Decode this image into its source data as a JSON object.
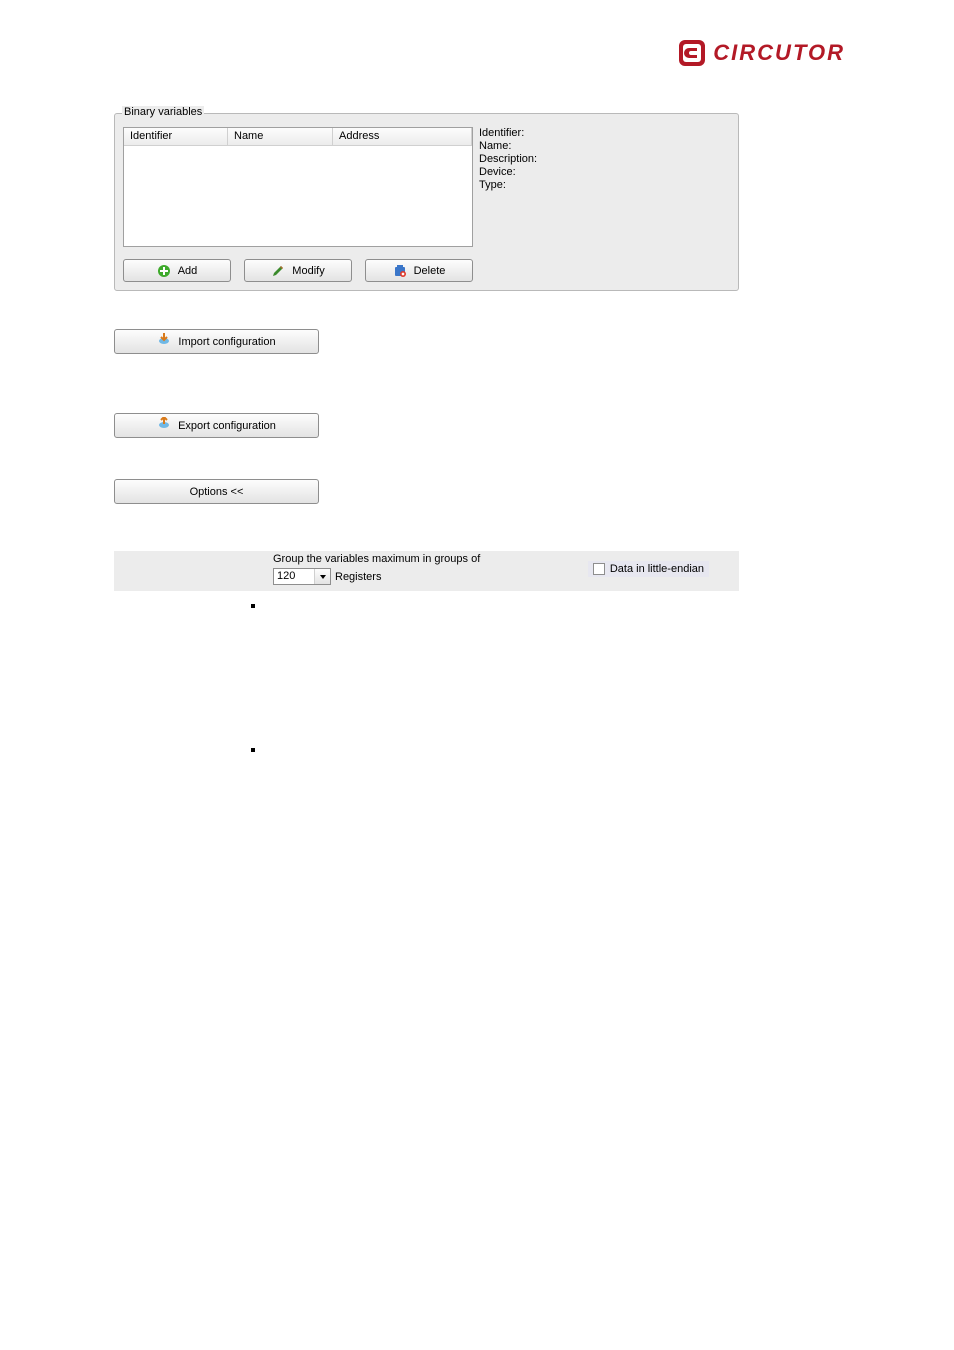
{
  "logo": {
    "text": "CIRCUTOR"
  },
  "fieldset": {
    "legend": "Binary variables",
    "columns": {
      "identifier": "Identifier",
      "name": "Name",
      "address": "Address"
    },
    "details": {
      "identifier": "Identifier:",
      "name": "Name:",
      "description": "Description:",
      "device": "Device:",
      "type": "Type:"
    },
    "buttons": {
      "add": "Add",
      "modify": "Modify",
      "delete": "Delete"
    }
  },
  "buttons": {
    "import": "Import configuration",
    "export": "Export configuration",
    "options": "Options <<"
  },
  "options": {
    "group_text": "Group the variables maximum in groups of",
    "registers_value": "120",
    "registers_label": "Registers",
    "little_endian": "Data in little-endian"
  }
}
